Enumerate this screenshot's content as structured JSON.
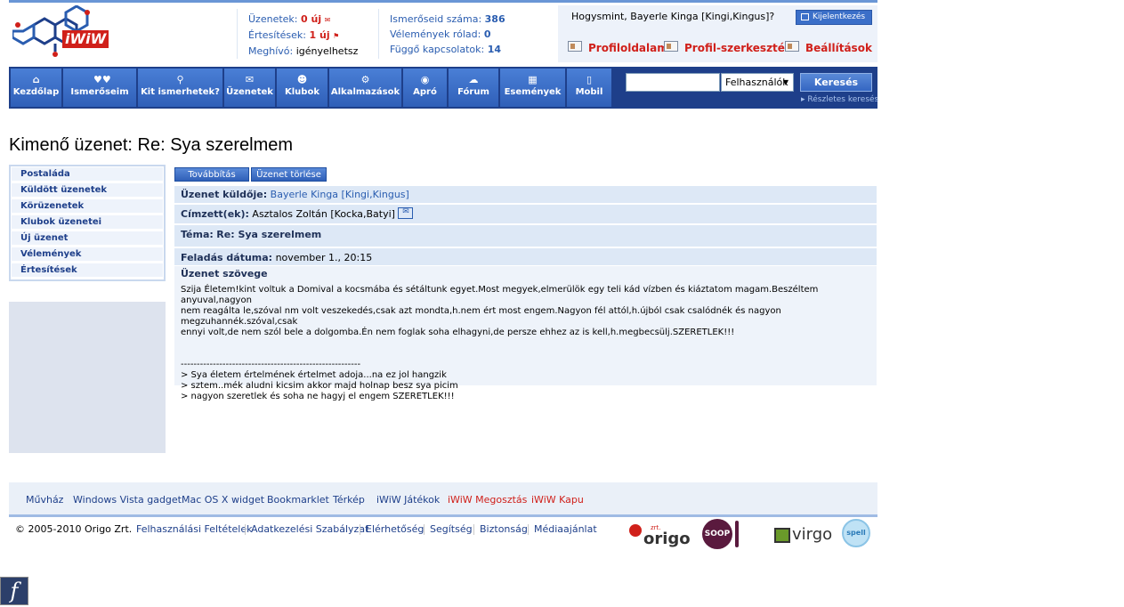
{
  "header": {
    "logo_text": "iWiW",
    "stats_left": [
      {
        "label": "Üzenetek:",
        "value": "0 új",
        "style": "red"
      },
      {
        "label": "Értesítések:",
        "value": "1 új",
        "style": "red"
      },
      {
        "label": "Meghívó:",
        "value": "igényelhetsz",
        "style": "plain"
      }
    ],
    "stats_right": [
      {
        "label": "Ismerőseid száma:",
        "value": "386"
      },
      {
        "label": "Vélemények rólad:",
        "value": "0"
      },
      {
        "label": "Függő kapcsolatok:",
        "value": "14"
      }
    ],
    "greeting": "Hogysmint, Bayerle Kinga [Kingi,Kingus]?",
    "logout_label": "Kijelentkezés",
    "profile_links": [
      "Profiloldalam",
      "Profil-szerkesztés",
      "Beállítások"
    ]
  },
  "nav": {
    "items": [
      {
        "label": "Kezdőlap",
        "icon": "home-icon",
        "glyph": "⌂"
      },
      {
        "label": "Ismerőseim",
        "icon": "friends-icon",
        "glyph": "♥♥"
      },
      {
        "label": "Kit ismerhetek?",
        "icon": "find-people-icon",
        "glyph": "⚲"
      },
      {
        "label": "Üzenetek",
        "icon": "envelope-icon",
        "glyph": "✉"
      },
      {
        "label": "Klubok",
        "icon": "clubs-icon",
        "glyph": "☻"
      },
      {
        "label": "Alkalmazások",
        "icon": "gears-icon",
        "glyph": "⚙"
      },
      {
        "label": "Apró",
        "icon": "classifieds-icon",
        "glyph": "◉"
      },
      {
        "label": "Fórum",
        "icon": "forum-icon",
        "glyph": "☁"
      },
      {
        "label": "Események",
        "icon": "calendar-icon",
        "glyph": "▦"
      },
      {
        "label": "Mobil",
        "icon": "mobile-icon",
        "glyph": "▯"
      }
    ],
    "search_value": "",
    "search_select": "Felhasználók",
    "search_button": "Keresés",
    "detailed_search": "Részletes keresés"
  },
  "page_title": "Kimenő üzenet: Re: Sya szerelmem",
  "left_menu": [
    "Postaláda",
    "Küldött üzenetek",
    "Körüzenetek",
    "Klubok üzenetei",
    "Új üzenet",
    "Vélemények",
    "Értesítések"
  ],
  "actions": {
    "forward": "Továbbítás",
    "delete": "Üzenet törlése"
  },
  "message": {
    "sender_label": "Üzenet küldője:",
    "sender": "Bayerle Kinga [Kingi,Kingus]",
    "recipient_label": "Címzett(ek):",
    "recipient": "Asztalos Zoltán [Kocka,Batyi]",
    "subject_label": "Téma:",
    "subject": "Re: Sya szerelmem",
    "date_label": "Feladás dátuma:",
    "date": "november 1., 20:15",
    "body_label": "Üzenet szövege",
    "body": "Szija Életem!kint voltuk a Domival a kocsmába és sétáltunk egyet.Most megyek,elmerülök egy teli kád vízben és kiáztatom magam.Beszéltem anyuval,nagyon\nnem reagálta le,szóval nm volt veszekedés,csak azt mondta,h.nem ért most engem.Nagyon fél attól,h.újból csak csalódnék és nagyon megzuhannék.szóval,csak\nennyi volt,de nem szól bele a dolgomba.Én nem foglak soha elhagyni,de persze ehhez az is kell,h.megbecsülj.SZERETLEK!!!\n\n\n--------------------------------------------------------\n> Sya életem értelmének értelmet adoja...na ez jol hangzik\n> sztem..mék aludni kicsim akkor majd holnap besz sya picim\n> nagyon szeretlek és soha ne hagyj el engem SZERETLEK!!!"
  },
  "footer": {
    "links_top": [
      {
        "label": "Művház",
        "style": "blue"
      },
      {
        "label": "Windows Vista gadget",
        "style": "blue"
      },
      {
        "label": "Mac OS X widget",
        "style": "blue"
      },
      {
        "label": "Bookmarklet",
        "style": "blue"
      },
      {
        "label": "Térkép",
        "style": "blue"
      },
      {
        "label": "iWiW Játékok",
        "style": "blue"
      },
      {
        "label": "iWiW Megosztás",
        "style": "red"
      },
      {
        "label": "iWiW Kapu",
        "style": "red"
      }
    ],
    "copyright": "© 2005-2010 Origo Zrt.",
    "links_bottom": [
      "Felhasználási Feltételek",
      "Adatkezelési Szabályzat",
      "Elérhetőség",
      "Segítség",
      "Biztonság",
      "Médiaajánlat"
    ],
    "brands": [
      "origo",
      "SOOP",
      "virgo",
      "spell"
    ],
    "origo_small": "zrt."
  },
  "colors": {
    "brand_blue": "#1e3f8a",
    "accent_red": "#d0201a",
    "link_blue": "#2a5db0"
  }
}
